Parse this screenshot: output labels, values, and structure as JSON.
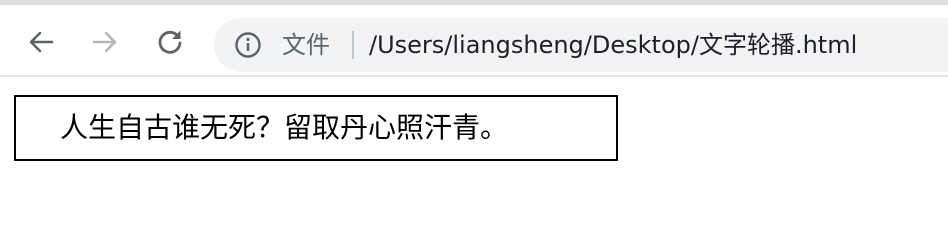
{
  "browser": {
    "icons": {
      "back": "arrow-left-icon",
      "forward": "arrow-right-icon",
      "reload": "reload-icon",
      "site_info": "info-icon"
    },
    "forward_enabled": false,
    "site_label": "文件",
    "url": "/Users/liangsheng/Desktop/文字轮播.html"
  },
  "page": {
    "carousel_text": "人生自古谁无死？留取丹心照汗青。"
  },
  "colors": {
    "icon_active": "#5f6368",
    "icon_disabled": "#b5b7ba",
    "omnibox_bg": "#f1f3f4",
    "url_text": "#202124",
    "box_border": "#000000"
  }
}
